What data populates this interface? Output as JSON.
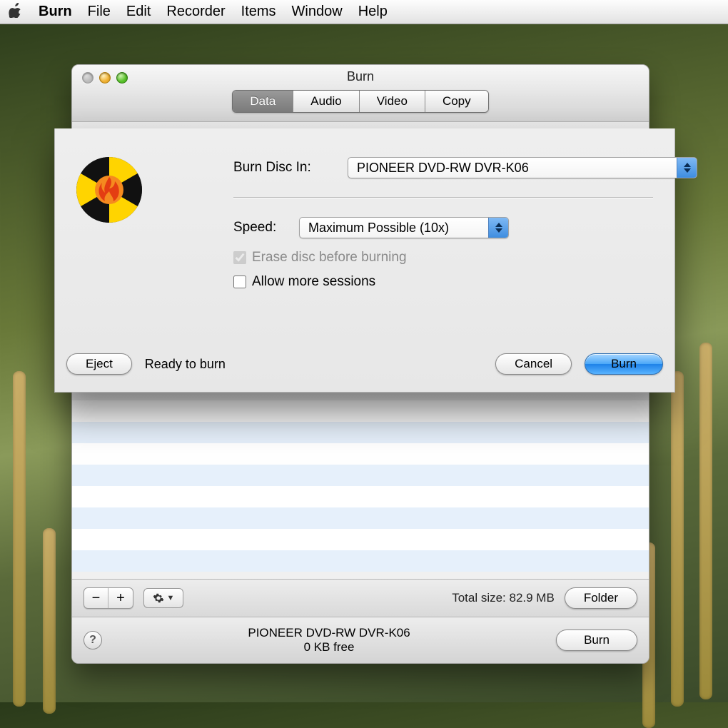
{
  "menubar": {
    "app": "Burn",
    "items": [
      "File",
      "Edit",
      "Recorder",
      "Items",
      "Window",
      "Help"
    ]
  },
  "window": {
    "title": "Burn",
    "tabs": [
      "Data",
      "Audio",
      "Video",
      "Copy"
    ],
    "active_tab": 0,
    "bottom": {
      "total_size_label": "Total size: 82.9 MB",
      "folder_button": "Folder"
    },
    "status": {
      "drive": "PIONEER DVD-RW DVR-K06",
      "free": "0 KB free",
      "burn_button": "Burn"
    },
    "buttons": {
      "minus": "−",
      "plus": "+",
      "help": "?"
    }
  },
  "sheet": {
    "burn_disc_label": "Burn Disc In:",
    "drive_value": "PIONEER DVD-RW DVR-K06",
    "speed_label": "Speed:",
    "speed_value": "Maximum Possible (10x)",
    "erase_label": "Erase disc before burning",
    "erase_checked": true,
    "sessions_label": "Allow more sessions",
    "sessions_checked": false,
    "eject_button": "Eject",
    "ready_text": "Ready to burn",
    "cancel_button": "Cancel",
    "burn_button": "Burn"
  }
}
